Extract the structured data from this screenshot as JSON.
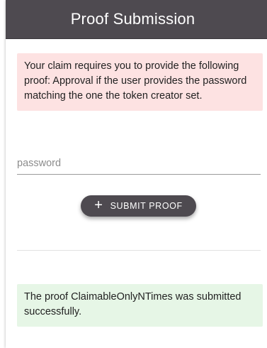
{
  "header": {
    "title": "Proof Submission"
  },
  "error_message": "Your claim requires you to provide the following proof: Approval if the user provides the password matching the one the token creator set.",
  "password_input": {
    "placeholder": "password",
    "value": ""
  },
  "submit_button": {
    "icon": "plus-icon",
    "label": "SUBMIT PROOF"
  },
  "success_message": "The proof ClaimableOnlyNTimes was submitted successfully.",
  "colors": {
    "header_bg": "#4e4a50",
    "button_bg": "#4e4a50",
    "error_bg": "#fde2e2",
    "success_bg": "#e6f6e6"
  }
}
